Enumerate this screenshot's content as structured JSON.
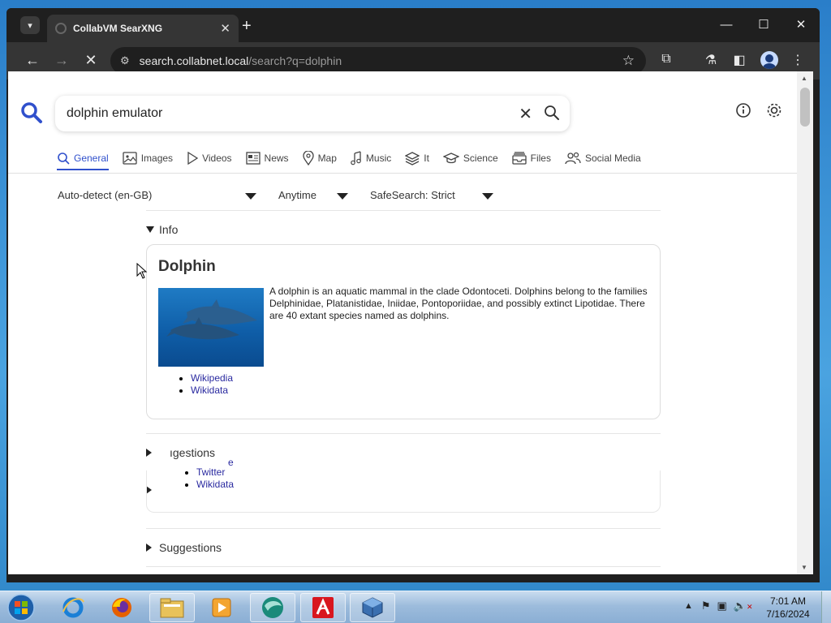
{
  "browser": {
    "tab_title": "CollabVM SearXNG",
    "url_host": "search.collabnet.local",
    "url_rest": "/search?q=dolphin"
  },
  "search": {
    "query": "dolphin emulator"
  },
  "categories": [
    {
      "label": "General",
      "icon": "search-icon",
      "active": true
    },
    {
      "label": "Images",
      "icon": "image-icon"
    },
    {
      "label": "Videos",
      "icon": "play-icon"
    },
    {
      "label": "News",
      "icon": "newspaper-icon"
    },
    {
      "label": "Map",
      "icon": "map-pin-icon"
    },
    {
      "label": "Music",
      "icon": "music-note-icon"
    },
    {
      "label": "It",
      "icon": "layers-icon"
    },
    {
      "label": "Science",
      "icon": "graduation-cap-icon"
    },
    {
      "label": "Files",
      "icon": "inbox-icon"
    },
    {
      "label": "Social Media",
      "icon": "people-icon"
    }
  ],
  "filters": {
    "language": "Auto-detect (en-GB)",
    "time": "Anytime",
    "safesearch": "SafeSearch: Strict"
  },
  "info": {
    "section_label": "Info",
    "title": "Dolphin",
    "description": "A dolphin is an aquatic mammal in the clade Odontoceti. Dolphins belong to the families Delphinidae, Platanistidae, Iniidae, Pontoporiidae, and possibly extinct Lipotidae. There are 40 extant species named as dolphins.",
    "links": [
      "Wikipedia",
      "Wikidata"
    ]
  },
  "overlay": {
    "section_label": "ıgestions",
    "ghost_char": "e",
    "links": [
      "Twitter",
      "Wikidata"
    ]
  },
  "suggestions": {
    "section_label": "Suggestions"
  },
  "taskbar": {
    "time": "7:01 AM",
    "date": "7/16/2024"
  }
}
